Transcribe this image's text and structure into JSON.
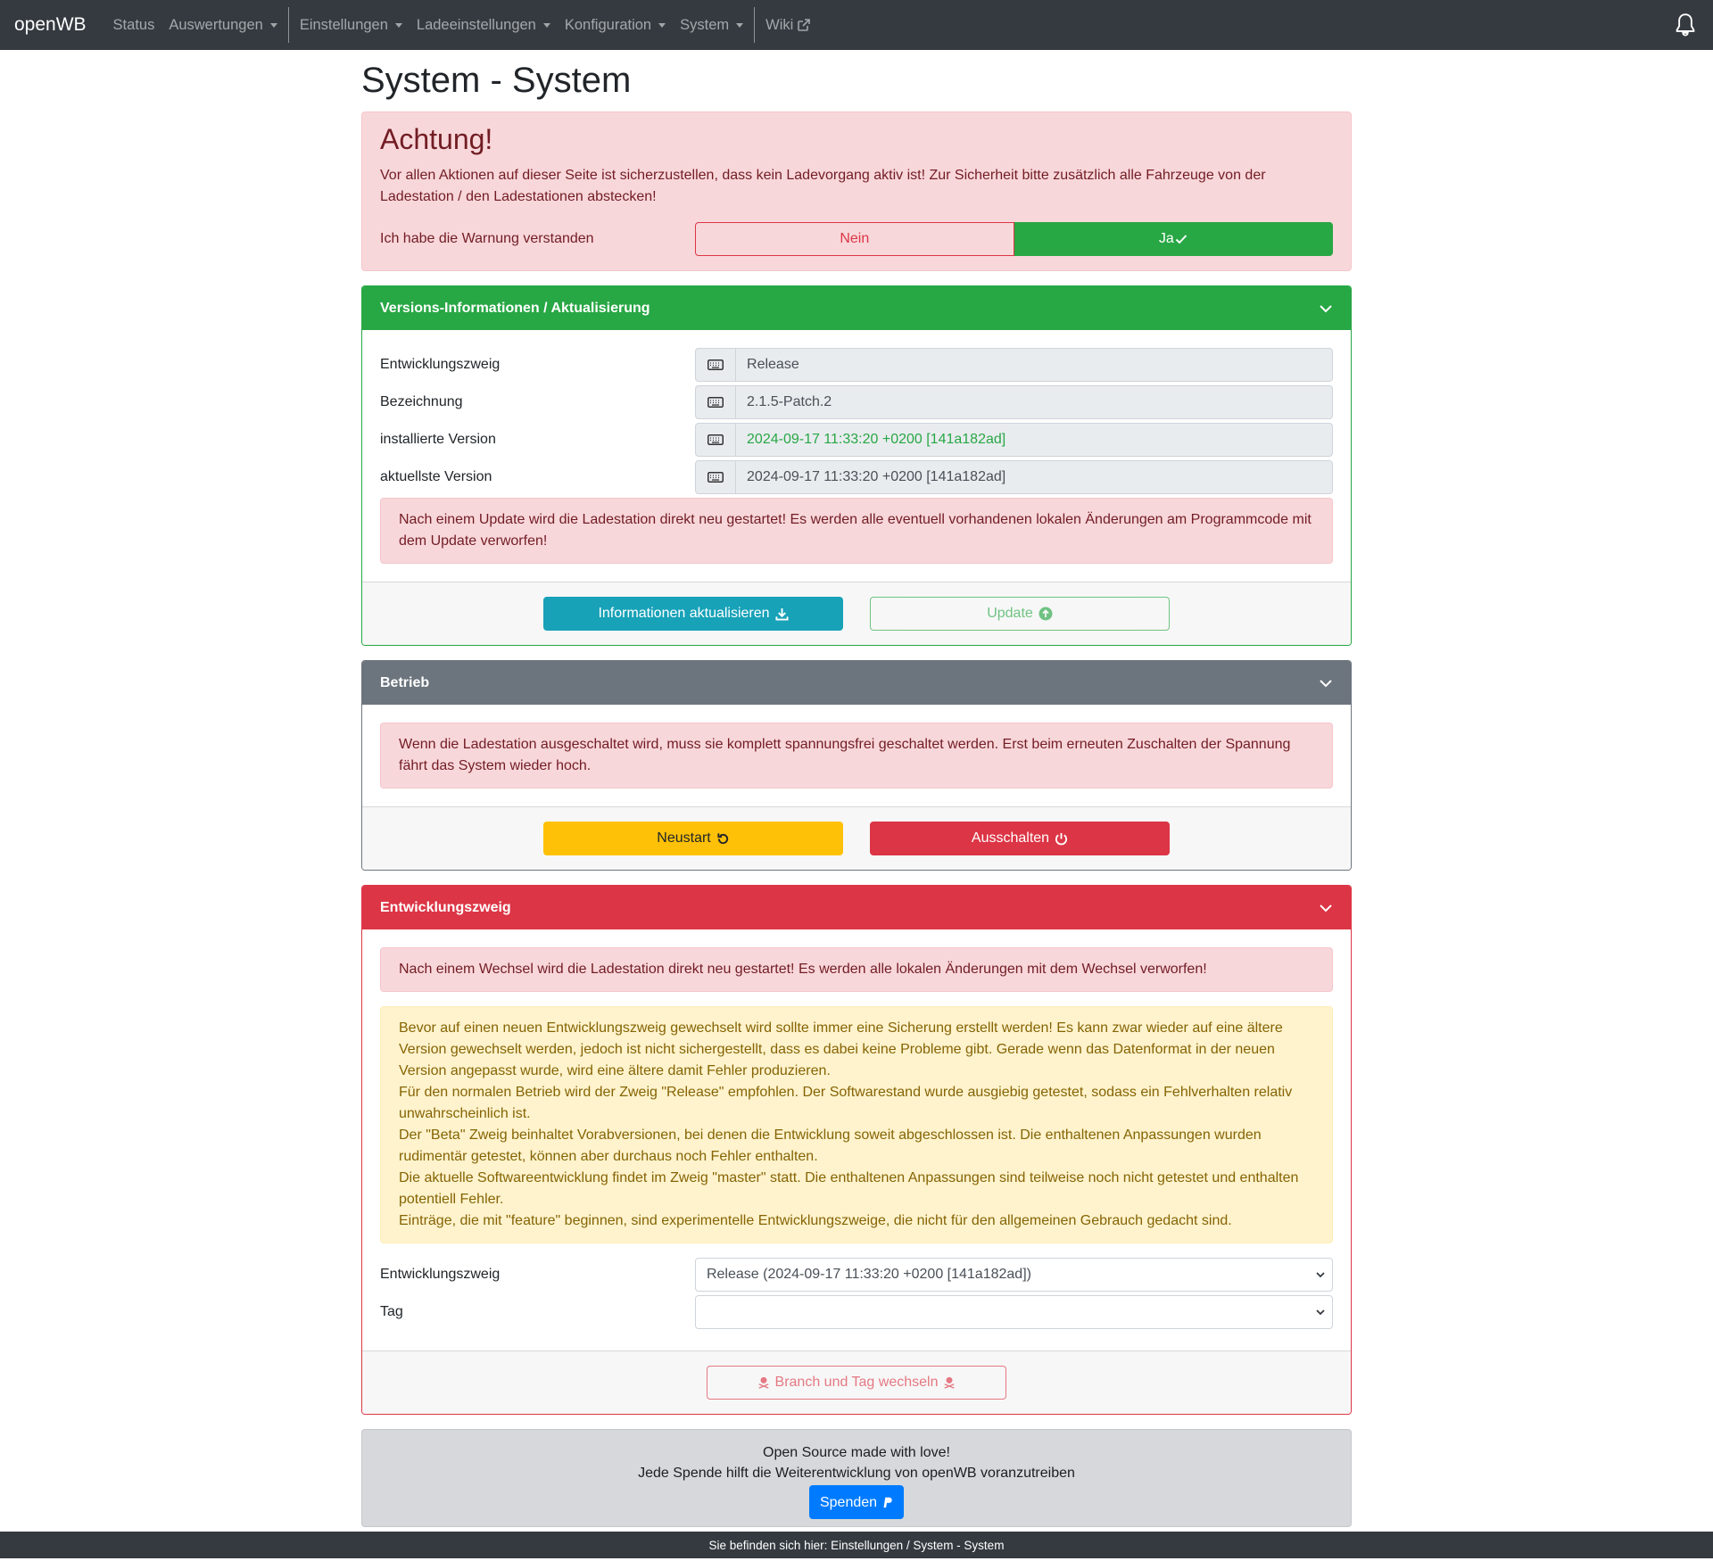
{
  "nav": {
    "brand": "openWB",
    "items": [
      "Status",
      "Auswertungen",
      "Einstellungen",
      "Ladeeinstellungen",
      "Konfiguration",
      "System",
      "Wiki"
    ]
  },
  "page_title": "System - System",
  "warning": {
    "heading": "Achtung!",
    "text": "Vor allen Aktionen auf dieser Seite ist sicherzustellen, dass kein Ladevorgang aktiv ist! Zur Sicherheit bitte zusätzlich alle Fahrzeuge von der Ladestation / den Ladestationen abstecken!",
    "confirm_label": "Ich habe die Warnung verstanden",
    "no_label": "Nein",
    "yes_label": "Ja",
    "selected": "Ja"
  },
  "versions": {
    "header": "Versions-Informationen / Aktualisierung",
    "rows": [
      {
        "label": "Entwicklungszweig",
        "value": "Release"
      },
      {
        "label": "Bezeichnung",
        "value": "2.1.5-Patch.2"
      },
      {
        "label": "installierte Version",
        "value": "2024-09-17 11:33:20 +0200 [141a182ad]"
      },
      {
        "label": "aktuellste Version",
        "value": "2024-09-17 11:33:20 +0200 [141a182ad]"
      }
    ],
    "alert": "Nach einem Update wird die Ladestation direkt neu gestartet! Es werden alle eventuell vorhandenen lokalen Änderungen am Programmcode mit dem Update verworfen!",
    "refresh_button": "Informationen aktualisieren",
    "update_button": "Update"
  },
  "betrieb": {
    "header": "Betrieb",
    "alert": "Wenn die Ladestation ausgeschaltet wird, muss sie komplett spannungsfrei geschaltet werden. Erst beim erneuten Zuschalten der Spannung fährt das System wieder hoch.",
    "restart_button": "Neustart",
    "shutdown_button": "Ausschalten"
  },
  "branch": {
    "header": "Entwicklungszweig",
    "alert_danger": "Nach einem Wechsel wird die Ladestation direkt neu gestartet! Es werden alle lokalen Änderungen mit dem Wechsel verworfen!",
    "warning_lines": [
      "Bevor auf einen neuen Entwicklungszweig gewechselt wird sollte immer eine Sicherung erstellt werden! Es kann zwar wieder auf eine ältere Version gewechselt werden, jedoch ist nicht sichergestellt, dass es dabei keine Probleme gibt. Gerade wenn das Datenformat in der neuen Version angepasst wurde, wird eine ältere damit Fehler produzieren.",
      "Für den normalen Betrieb wird der Zweig \"Release\" empfohlen. Der Softwarestand wurde ausgiebig getestet, sodass ein Fehlverhalten relativ unwahrscheinlich ist.",
      "Der \"Beta\" Zweig beinhaltet Vorabversionen, bei denen die Entwicklung soweit abgeschlossen ist. Die enthaltenen Anpassungen wurden rudimentär getestet, können aber durchaus noch Fehler enthalten.",
      "Die aktuelle Softwareentwicklung findet im Zweig \"master\" statt. Die enthaltenen Anpassungen sind teilweise noch nicht getestet und enthalten potentiell Fehler.",
      "Einträge, die mit \"feature\" beginnen, sind experimentelle Entwicklungszweige, die nicht für den allgemeinen Gebrauch gedacht sind."
    ],
    "branch_label": "Entwicklungszweig",
    "branch_value": "Release (2024-09-17 11:33:20 +0200 [141a182ad])",
    "tag_label": "Tag",
    "tag_value": "",
    "switch_button": "Branch und Tag wechseln"
  },
  "footer": {
    "line1": "Open Source made with love!",
    "line2": "Jede Spende hilft die Weiterentwicklung von openWB voranzutreiben",
    "donate_button": "Spenden"
  },
  "breadcrumb": "Sie befinden sich hier: Einstellungen / System - System",
  "colors": {
    "navbar": "#343a40",
    "success": "#28a745",
    "secondary": "#6c757d",
    "danger": "#dc3545",
    "info": "#17a2b8",
    "warning": "#ffc107",
    "primary": "#007bff"
  }
}
